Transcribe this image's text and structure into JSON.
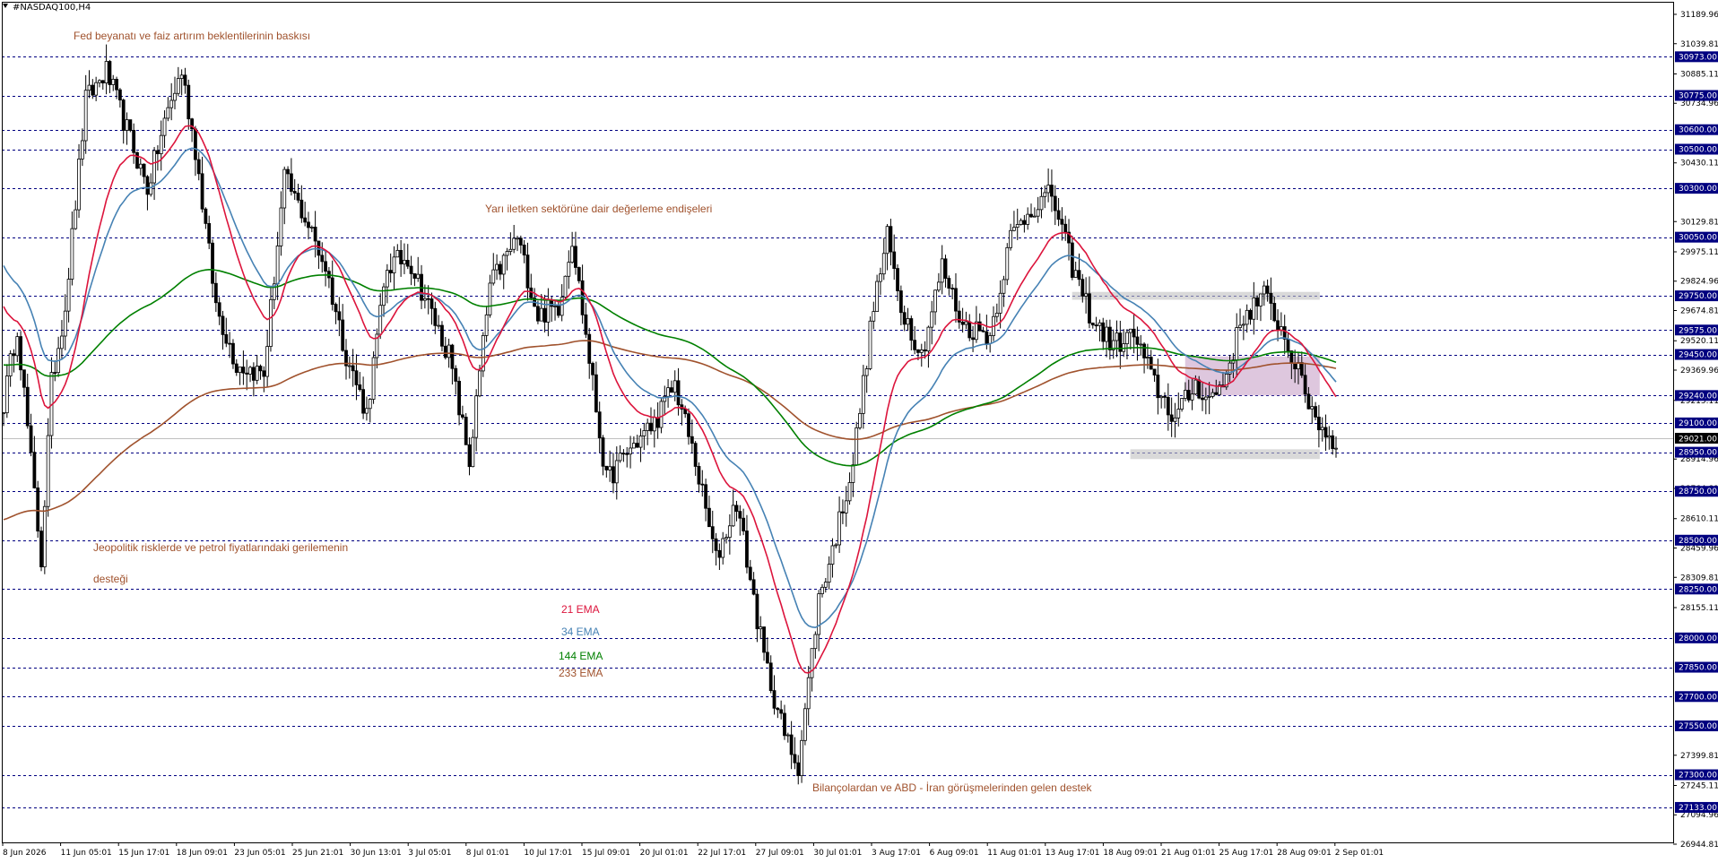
{
  "window": {
    "symbol_title": "#NASDAQ100,H4",
    "title_icon": "triangle-down-icon"
  },
  "chart_data": {
    "type": "candlestick",
    "symbol": "#NASDAQ100",
    "timeframe": "H4",
    "ylim": [
      26944.81,
      31189.96
    ],
    "current_price": 29021.0,
    "colors": {
      "ema21": "#dc143c",
      "ema34": "#4682b4",
      "ema144": "#008000",
      "ema233": "#a0522d",
      "level_line": "#000080",
      "annotation": "#a0522d",
      "zone_gray": "#c0c0c0",
      "zone_purple": "#c8a2c8"
    },
    "x_ticks": [
      "8 Jun 2026",
      "11 Jun 05:01",
      "15 Jun 17:01",
      "18 Jun 09:01",
      "23 Jun 05:01",
      "25 Jun 21:01",
      "30 Jun 13:01",
      "3 Jul 05:01",
      "8 Jul 01:01",
      "10 Jul 17:01",
      "15 Jul 09:01",
      "20 Jul 01:01",
      "22 Jul 17:01",
      "27 Jul 09:01",
      "30 Jul 01:01",
      "3 Aug 17:01",
      "6 Aug 09:01",
      "11 Aug 01:01",
      "13 Aug 17:01",
      "18 Aug 09:01",
      "21 Aug 01:01",
      "25 Aug 17:01",
      "28 Aug 09:01",
      "2 Sep 01:01"
    ],
    "y_ticks": [
      "31189.96",
      "31039.81",
      "30885.11",
      "30734.96",
      "30430.11",
      "30129.81",
      "29975.11",
      "29824.96",
      "29674.81",
      "29520.11",
      "29369.96",
      "29215.11",
      "28914.96",
      "28764.81",
      "28610.11",
      "28459.96",
      "28309.81",
      "28155.11",
      "27399.81",
      "27245.11",
      "27094.96",
      "26944.81"
    ],
    "levels": [
      "30973.00",
      "30775.00",
      "30600.00",
      "30500.00",
      "30300.00",
      "30050.00",
      "29750.00",
      "29575.00",
      "29450.00",
      "29240.00",
      "29100.00",
      "28950.00",
      "28750.00",
      "28500.00",
      "28250.00",
      "28000.00",
      "27850.00",
      "27700.00",
      "27550.00",
      "27300.00",
      "27133.00"
    ],
    "current_price_label": "29021.00",
    "annotations": [
      "Fed beyanatı ve faiz artırım beklentilerinin baskısı",
      "Yarı iletken sektörüne dair değerleme endişeleri",
      "Jeopolitik risklerde ve petrol fiyatlarındaki gerilemenin",
      "desteği",
      "Bilançolardan ve ABD - İran görüşmelerinden gelen destek"
    ],
    "legend": [
      "21 EMA",
      "34 EMA",
      "144 EMA",
      "233 EMA"
    ],
    "zones": [
      {
        "type": "gray",
        "from": "18 Aug 09:01",
        "to": "2 Sep 01:01",
        "y_top": 29770,
        "y_bottom": 29730
      },
      {
        "type": "purple",
        "from": "25 Aug 17:01",
        "to": "2 Sep 01:01",
        "y_top": 29440,
        "y_bottom": 29240
      },
      {
        "type": "gray",
        "from": "21 Aug 01:01",
        "to": "2 Sep 01:01",
        "y_top": 28965,
        "y_bottom": 28915
      }
    ],
    "waypoints": [
      [
        0,
        29200
      ],
      [
        4,
        29600
      ],
      [
        8,
        28900
      ],
      [
        11,
        28400
      ],
      [
        14,
        29300
      ],
      [
        18,
        29700
      ],
      [
        24,
        30750
      ],
      [
        30,
        30900
      ],
      [
        38,
        30500
      ],
      [
        42,
        30300
      ],
      [
        48,
        30700
      ],
      [
        52,
        30900
      ],
      [
        56,
        30500
      ],
      [
        62,
        29700
      ],
      [
        68,
        29400
      ],
      [
        76,
        29350
      ],
      [
        82,
        30350
      ],
      [
        88,
        30150
      ],
      [
        94,
        29900
      ],
      [
        100,
        29450
      ],
      [
        106,
        29150
      ],
      [
        112,
        29900
      ],
      [
        118,
        29950
      ],
      [
        124,
        29700
      ],
      [
        130,
        29450
      ],
      [
        136,
        28900
      ],
      [
        142,
        29800
      ],
      [
        150,
        30050
      ],
      [
        156,
        29650
      ],
      [
        162,
        29700
      ],
      [
        166,
        30050
      ],
      [
        170,
        29550
      ],
      [
        176,
        28800
      ],
      [
        182,
        28950
      ],
      [
        190,
        29100
      ],
      [
        196,
        29300
      ],
      [
        202,
        28900
      ],
      [
        208,
        28400
      ],
      [
        214,
        28700
      ],
      [
        222,
        27900
      ],
      [
        228,
        27500
      ],
      [
        232,
        27350
      ],
      [
        238,
        28200
      ],
      [
        242,
        28450
      ],
      [
        248,
        28900
      ],
      [
        254,
        29700
      ],
      [
        258,
        30050
      ],
      [
        262,
        29700
      ],
      [
        268,
        29450
      ],
      [
        274,
        29900
      ],
      [
        280,
        29600
      ],
      [
        288,
        29550
      ],
      [
        294,
        30050
      ],
      [
        300,
        30200
      ],
      [
        306,
        30270
      ],
      [
        312,
        29900
      ],
      [
        318,
        29620
      ],
      [
        324,
        29500
      ],
      [
        330,
        29550
      ],
      [
        336,
        29300
      ],
      [
        342,
        29120
      ],
      [
        348,
        29300
      ],
      [
        352,
        29220
      ],
      [
        356,
        29300
      ],
      [
        362,
        29650
      ],
      [
        368,
        29750
      ],
      [
        372,
        29620
      ],
      [
        376,
        29450
      ],
      [
        380,
        29250
      ],
      [
        384,
        29100
      ],
      [
        388,
        29000
      ]
    ]
  }
}
